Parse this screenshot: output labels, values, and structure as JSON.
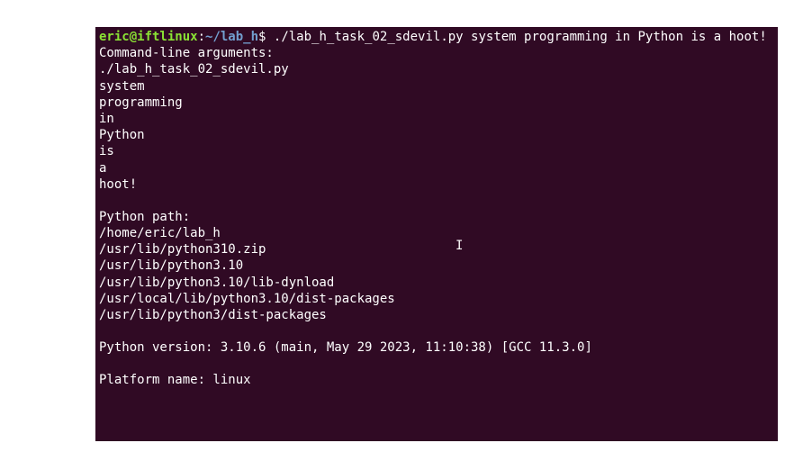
{
  "prompt": {
    "user": "eric@iftlinux",
    "colon": ":",
    "path": "~/lab_h",
    "dollar": "$ "
  },
  "command": "./lab_h_task_02_sdevil.py system programming in Python is a hoot!",
  "output": {
    "line1": "Command-line arguments:",
    "line2": "./lab_h_task_02_sdevil.py",
    "line3": "system",
    "line4": "programming",
    "line5": "in",
    "line6": "Python",
    "line7": "is",
    "line8": "a",
    "line9": "hoot!",
    "line10": "",
    "line11": "Python path:",
    "line12": "/home/eric/lab_h",
    "line13": "/usr/lib/python310.zip",
    "line14": "/usr/lib/python3.10",
    "line15": "/usr/lib/python3.10/lib-dynload",
    "line16": "/usr/local/lib/python3.10/dist-packages",
    "line17": "/usr/lib/python3/dist-packages",
    "line18": "",
    "line19": "Python version: 3.10.6 (main, May 29 2023, 11:10:38) [GCC 11.3.0]",
    "line20": "",
    "line21": "Platform name: linux"
  },
  "cursor": "I"
}
